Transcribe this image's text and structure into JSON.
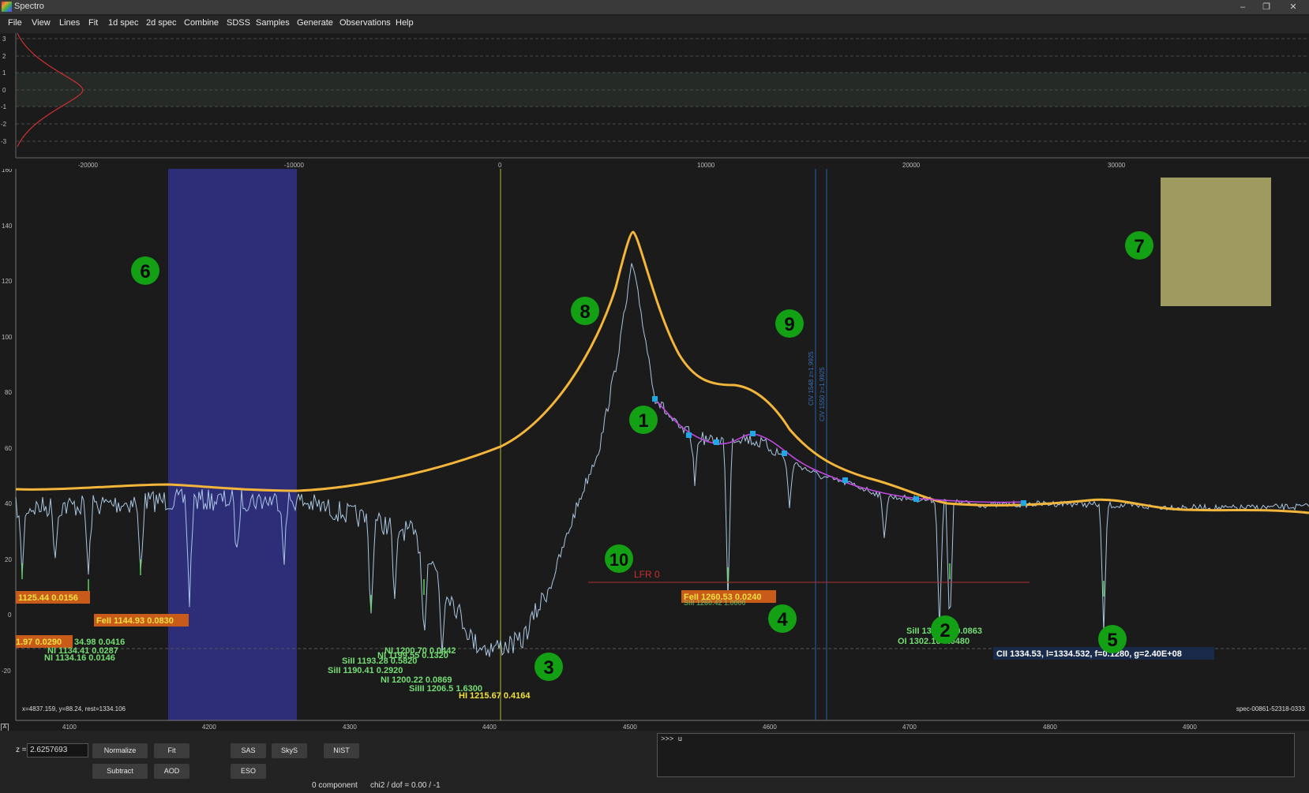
{
  "window": {
    "title": "Spectro",
    "controls": {
      "minimize": "–",
      "restore": "❐",
      "close": "✕"
    }
  },
  "menu": [
    "File",
    "View",
    "Lines",
    "Fit",
    "1d spec",
    "2d spec",
    "Combine",
    "SDSS",
    "Samples",
    "Generate",
    "Observations",
    "Help"
  ],
  "top_plot": {
    "y_ticks": [
      "3",
      "2",
      "1",
      "0",
      "-1",
      "-2",
      "-3"
    ],
    "x_ticks": [
      "-20000",
      "-10000",
      "0",
      "10000",
      "20000",
      "30000"
    ]
  },
  "main_plot": {
    "y_ticks": [
      "160",
      "140",
      "120",
      "100",
      "80",
      "60",
      "40",
      "20",
      "0",
      "-20"
    ],
    "x_ticks": [
      "4100",
      "4200",
      "4300",
      "4400",
      "4500",
      "4600",
      "4700",
      "4800",
      "4900"
    ],
    "cursor_info": "x=4837.159, y=88.24, rest=1334.106",
    "spectrum_name": "spec-00861-52318-0333",
    "lfr_label": "LFR 0",
    "doublet_labels": [
      "CIV 1548  z=1.9925",
      "CIV 1550  z=1.9925"
    ],
    "highlighted_lines": [
      "1125.44 0.0156",
      "FeII 1144.93 0.0830",
      "1.97 0.0290",
      "FeII 1260.53 0.0240"
    ],
    "green_lines": [
      "34.98 0.0416",
      "NI 1134.41 0.0287",
      "NI 1134.16 0.0146",
      "NI 1200.70 0.0442",
      "NI 1199.55 0.1320",
      "SiII 1193.28 0.5820",
      "SiII 1190.41 0.2920",
      "NI 1200.22 0.0869",
      "SiIII 1206.5 1.6300",
      "SiII 1304.37 0.0863",
      "OI 1302.16 0.0480",
      "SiII 1260.42 1.0000"
    ],
    "hi_label": "HI 1215.67 0.4164",
    "tooltip": "CII 1334.53, l=1334.532, f=0.1280, g=2.40E+08",
    "markers": [
      "1",
      "2",
      "3",
      "4",
      "5",
      "6",
      "7",
      "8",
      "9",
      "10"
    ]
  },
  "controls": {
    "z_label": "z =",
    "z_value": "2.6257693",
    "buttons": {
      "normalize": "Normalize",
      "fit": "Fit",
      "subtract": "Subtract",
      "aod": "AOD",
      "sas": "SAS",
      "skys": "SkyS",
      "nist": "NIST",
      "eso": "ESO"
    },
    "console_prompt": ">>> u",
    "status_components": "0 component",
    "status_chi2": "chi2 / dof = 0.00 / -1"
  },
  "corner_label": "A",
  "colors": {
    "background": "#1b1b1b",
    "spectrum": "#a9c6e2",
    "model": "#f3b53a",
    "fit": "#c048e0",
    "fit_points": "#1fa8e8",
    "absorption_marks": "#5fd05f",
    "line_label_green": "#74de74",
    "line_label_yellow": "#f0e040",
    "highlight_bg": "#c85a1a",
    "highlight_text": "#f0e040",
    "region_blue": "#2d2d78",
    "region_olive": "#9e9a60",
    "marker_green": "#14a014"
  }
}
